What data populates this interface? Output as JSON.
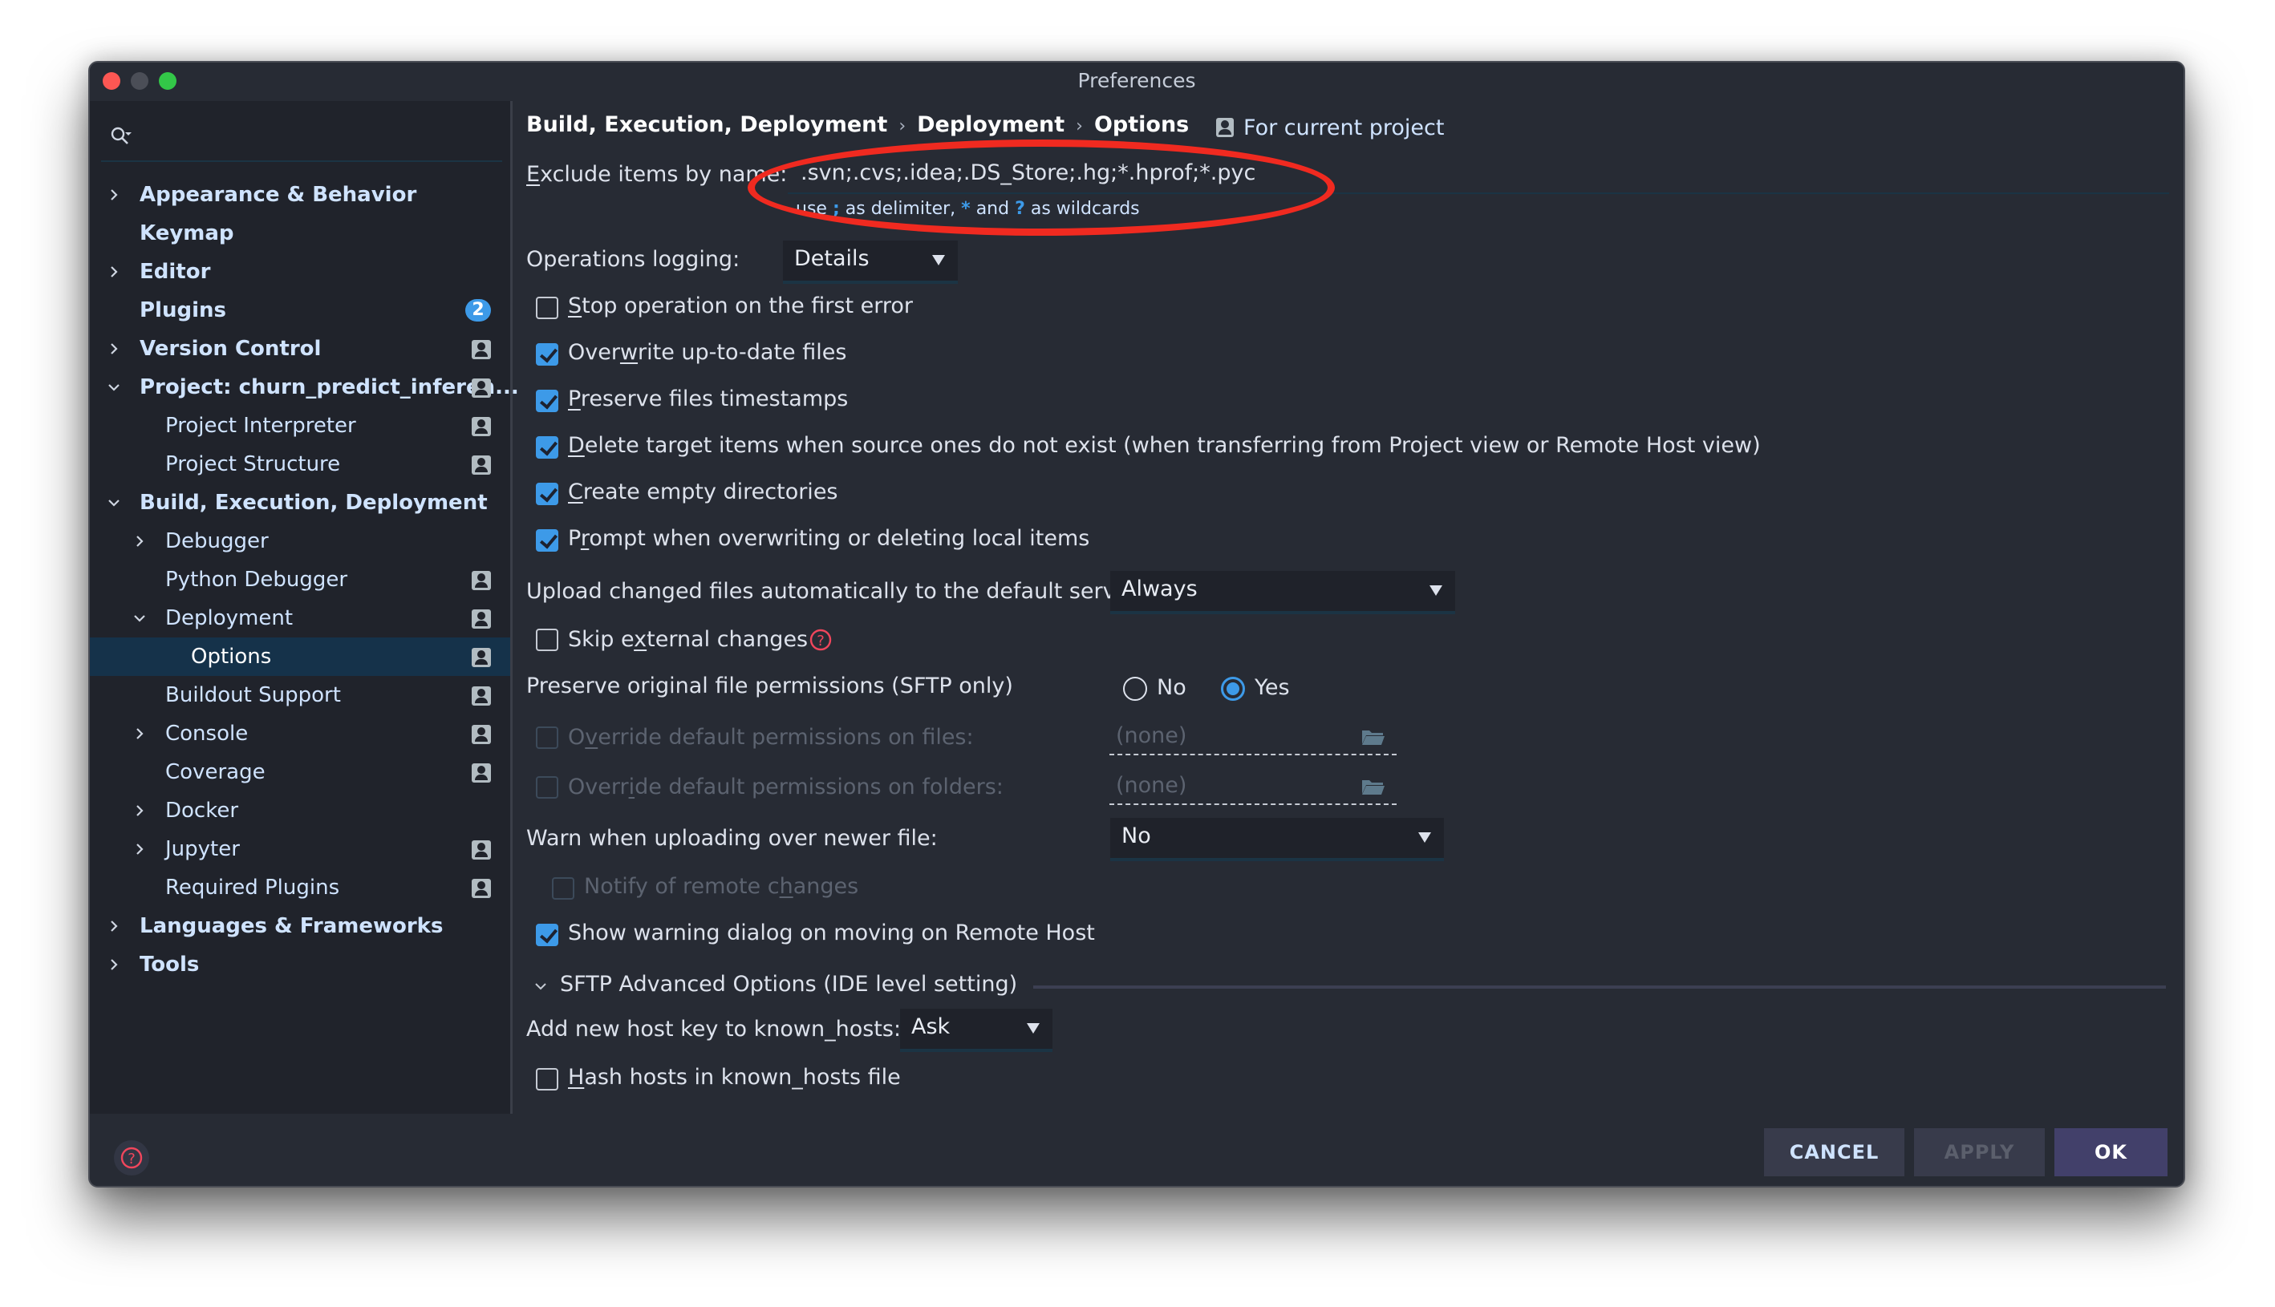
{
  "window": {
    "title": "Preferences"
  },
  "sidebar": {
    "search_placeholder": "",
    "items": [
      {
        "label": "Appearance & Behavior",
        "level": 0,
        "chevron": "right",
        "bold": true,
        "profile_icon": false
      },
      {
        "label": "Keymap",
        "level": 0,
        "chevron": "none",
        "bold": true,
        "profile_icon": false
      },
      {
        "label": "Editor",
        "level": 0,
        "chevron": "right",
        "bold": true,
        "profile_icon": false
      },
      {
        "label": "Plugins",
        "level": 0,
        "chevron": "none",
        "bold": true,
        "badge": "2"
      },
      {
        "label": "Version Control",
        "level": 0,
        "chevron": "right",
        "bold": true,
        "profile_icon": true
      },
      {
        "label": "Project: churn_predict_inferen...",
        "level": 0,
        "chevron": "down",
        "bold": true,
        "profile_icon": true
      },
      {
        "label": "Project Interpreter",
        "level": 1,
        "chevron": "none",
        "profile_icon": true
      },
      {
        "label": "Project Structure",
        "level": 1,
        "chevron": "none",
        "profile_icon": true
      },
      {
        "label": "Build, Execution, Deployment",
        "level": 0,
        "chevron": "down",
        "bold": true,
        "profile_icon": false
      },
      {
        "label": "Debugger",
        "level": 1,
        "chevron": "right",
        "profile_icon": false
      },
      {
        "label": "Python Debugger",
        "level": 1,
        "chevron": "none",
        "profile_icon": true
      },
      {
        "label": "Deployment",
        "level": 1,
        "chevron": "down",
        "profile_icon": true
      },
      {
        "label": "Options",
        "level": 2,
        "chevron": "none",
        "profile_icon": true,
        "selected": true
      },
      {
        "label": "Buildout Support",
        "level": 1,
        "chevron": "none",
        "profile_icon": true
      },
      {
        "label": "Console",
        "level": 1,
        "chevron": "right",
        "profile_icon": true
      },
      {
        "label": "Coverage",
        "level": 1,
        "chevron": "none",
        "profile_icon": true
      },
      {
        "label": "Docker",
        "level": 1,
        "chevron": "right",
        "profile_icon": false
      },
      {
        "label": "Jupyter",
        "level": 1,
        "chevron": "right",
        "profile_icon": true
      },
      {
        "label": "Required Plugins",
        "level": 1,
        "chevron": "none",
        "profile_icon": true
      },
      {
        "label": "Languages & Frameworks",
        "level": 0,
        "chevron": "right",
        "bold": true,
        "profile_icon": false
      },
      {
        "label": "Tools",
        "level": 0,
        "chevron": "right",
        "bold": true,
        "profile_icon": false
      }
    ]
  },
  "header": {
    "breadcrumb": [
      "Build, Execution, Deployment",
      "Deployment",
      "Options"
    ],
    "breadcrumb_separator": "›",
    "scope_label": "For current project"
  },
  "form": {
    "exclude": {
      "label_mnemonic": "E",
      "label_rest": "xclude items by name:",
      "value": ".svn;.cvs;.idea;.DS_Store;.hg;*.hprof;*.pyc",
      "hint_prefix": "use",
      "hint_delim": ";",
      "hint_mid1": "as delimiter,",
      "hint_star": "*",
      "hint_and": "and",
      "hint_q": "?",
      "hint_suffix": "as wildcards"
    },
    "operations_logging": {
      "label": "Operations logging:",
      "value": "Details"
    },
    "checkboxes": [
      {
        "pre": "",
        "mn": "S",
        "post": "top operation on the first error",
        "checked": false
      },
      {
        "pre": "Over",
        "mn": "w",
        "post": "rite up-to-date files",
        "checked": true
      },
      {
        "pre": "",
        "mn": "P",
        "post": "reserve files timestamps",
        "checked": true
      },
      {
        "pre": "",
        "mn": "D",
        "post": "elete target items when source ones do not exist (when transferring from Project view or Remote Host view)",
        "checked": true
      },
      {
        "pre": "",
        "mn": "C",
        "post": "reate empty directories",
        "checked": true
      },
      {
        "pre": "P",
        "mn": "r",
        "post": "ompt when overwriting or deleting local items",
        "checked": true
      }
    ],
    "upload": {
      "label": "Upload changed files automatically to the default server",
      "value": "Always"
    },
    "skip_external": {
      "pre": "Skip e",
      "mn": "x",
      "post": "ternal changes",
      "checked": false
    },
    "preserve_permissions": {
      "label": "Preserve original file permissions (SFTP only)",
      "options": [
        {
          "label": "No",
          "checked": false
        },
        {
          "label": "Yes",
          "checked": true
        }
      ]
    },
    "override_files": {
      "pre": "O",
      "mn": "v",
      "post": "erride default permissions on files:",
      "checked": false,
      "disabled": true,
      "value": "(none)"
    },
    "override_folders": {
      "pre": "Overr",
      "mn": "i",
      "post": "de default permissions on folders:",
      "checked": false,
      "disabled": true,
      "value": "(none)"
    },
    "warn_newer": {
      "label": "Warn when uploading over newer file:",
      "value": "No"
    },
    "notify_remote": {
      "pre": "Notify of remote c",
      "mn": "h",
      "post": "anges",
      "checked": false,
      "disabled": true
    },
    "show_warning": {
      "label": "Show warning dialog on moving on Remote Host",
      "checked": true
    },
    "sftp_section": {
      "label": "SFTP Advanced Options (IDE level setting)",
      "expanded": true
    },
    "add_host_key": {
      "label": "Add new host key to known_hosts:",
      "value": "Ask"
    },
    "hash_hosts": {
      "pre": "",
      "mn": "H",
      "post": "ash hosts in known_hosts file",
      "checked": false
    }
  },
  "footer": {
    "cancel_label": "CANCEL",
    "apply_label": "APPLY",
    "ok_label": "OK"
  },
  "colors": {
    "accent": "#3d9ae8",
    "annotation": "#f02a20",
    "help": "#f0465c",
    "ok_button": "#42406a",
    "selected_row": "#15324a"
  }
}
